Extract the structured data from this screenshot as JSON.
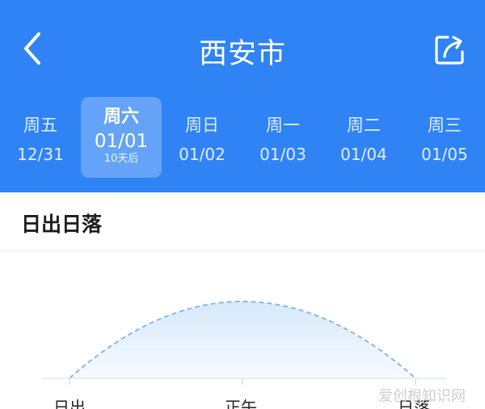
{
  "header": {
    "city": "西安市",
    "back_icon": "chevron-left-icon",
    "share_icon": "share-icon",
    "background_color": "#2f83f5"
  },
  "days": [
    {
      "weekday": "周五",
      "date": "12/31"
    },
    {
      "weekday": "周六",
      "date": "01/01",
      "relative": "10天后",
      "selected": true
    },
    {
      "weekday": "周日",
      "date": "01/02"
    },
    {
      "weekday": "周一",
      "date": "01/03"
    },
    {
      "weekday": "周二",
      "date": "01/04"
    },
    {
      "weekday": "周三",
      "date": "01/05"
    }
  ],
  "sun": {
    "section_title": "日出日落",
    "labels": {
      "sunrise": "日出",
      "noon": "正午",
      "sunset": "日落"
    }
  },
  "watermark": "爱创根知识网"
}
